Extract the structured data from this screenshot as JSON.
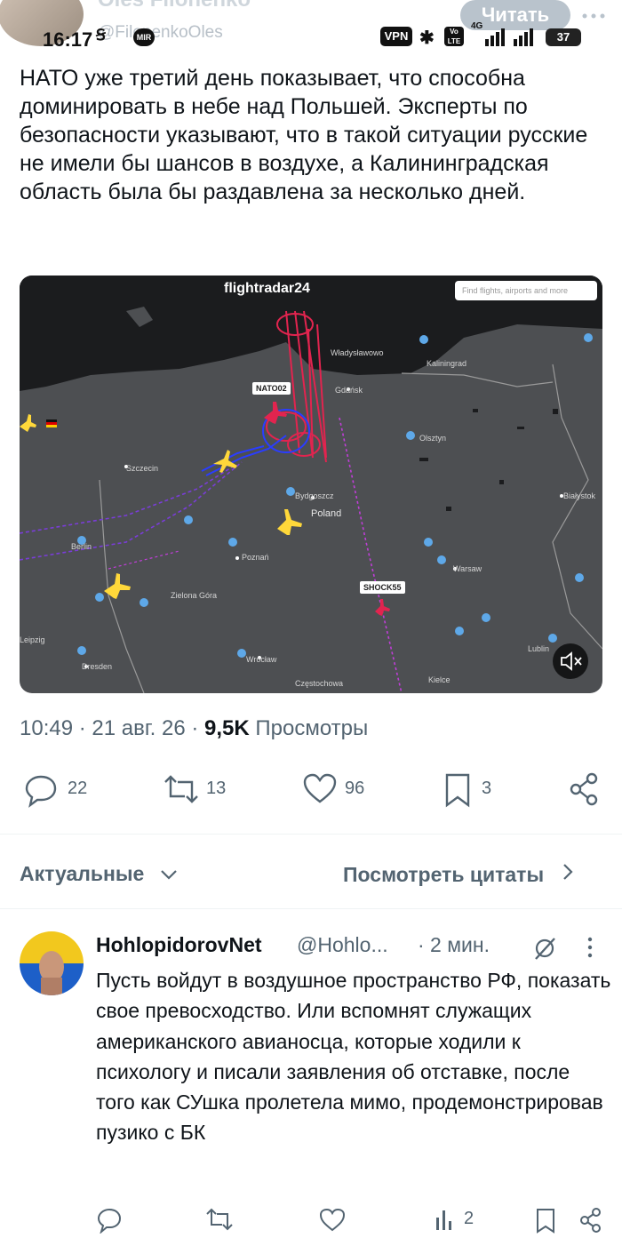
{
  "header": {
    "author_faded": "Oles Filonenko",
    "handle_faded": "@FilonenkoOles",
    "read_button": "Читать"
  },
  "status_bar": {
    "time": "16:17",
    "vpn": "VPN",
    "network": "4G",
    "battery": "37"
  },
  "post": {
    "text": "НАТО уже третий день показывает, что способна доминировать в небе над Польшей. Эксперты по безопасности указывают, что в такой ситуации русские не имели бы шансов в воздухе, а Калининградская область была бы раздавлена за несколько дней.",
    "timestamp": "10:49 · 21 авг. 26 · ",
    "views_count": "9,5K",
    "views_label": " Просмотры"
  },
  "video": {
    "logo": "flightradar24",
    "search_placeholder": "Find flights, airports and more",
    "tags": [
      "NATO02",
      "SHOCK55"
    ],
    "cities": [
      "Gdańsk",
      "Bydgoszcz",
      "Poland",
      "Poznań",
      "Warsaw",
      "Szczecin",
      "Berlin",
      "Wrocław",
      "Białystok",
      "Lublin",
      "Olsztyn",
      "Częstochowa",
      "Kielce",
      "Dresden",
      "Leipzig",
      "Zielona Góra",
      "Władysławowo",
      "Kaliningrad"
    ]
  },
  "actions": {
    "replies": "22",
    "reposts": "13",
    "likes": "96",
    "bookmarks": "3"
  },
  "tabs": {
    "relevant": "Актуальные",
    "quotes": "Посмотреть цитаты"
  },
  "reply": {
    "name": "HohlopidorovNet",
    "handle": "@Hohlo...",
    "time": "· 2 мин.",
    "text": "Пусть войдут в воздушное пространство РФ, показать свое превосходство. Или вспомнят служащих американского авианосца, которые ходили к психологу и писали заявления об отставке, после того как СУшка пролетела мимо, продемонстрировав пузико с БК",
    "views": "2"
  },
  "colors": {
    "text": "#0f1419",
    "secondary": "#536471",
    "map_bg": "#4d4f52",
    "track_red": "#e2244f",
    "track_blue": "#2a3dff",
    "track_purple": "#7a3dd8"
  }
}
